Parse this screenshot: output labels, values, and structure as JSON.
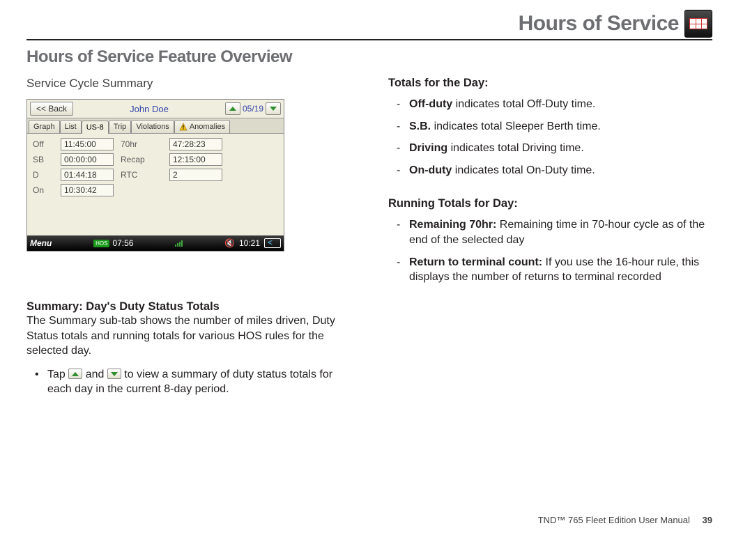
{
  "header": {
    "title": "Hours of Service"
  },
  "h2": "Hours of Service Feature Overview",
  "left": {
    "subhead": "Service Cycle Summary",
    "summary_head": "Summary: Day's Duty Status Totals",
    "summary_body": "The Summary sub-tab shows the number of miles driven, Duty Status totals and running totals for various HOS rules for the selected day.",
    "bullet_pre": "Tap ",
    "bullet_mid": " and ",
    "bullet_post": " to view a summary of duty status totals for each day in the current 8-day period."
  },
  "right": {
    "totals_head": "Totals for the Day:",
    "totals": [
      {
        "b": "Off-duty",
        "t": " indicates total Off-Duty time."
      },
      {
        "b": "S.B.",
        "t": " indicates total Sleeper Berth time."
      },
      {
        "b": "Driving",
        "t": " indicates total Driving time."
      },
      {
        "b": "On-duty",
        "t": " indicates total On-Duty time."
      }
    ],
    "running_head": "Running Totals for Day:",
    "running": [
      {
        "b": "Remaining 70hr:",
        "t": " Remaining time in 70-hour cycle as of the end of the selected day"
      },
      {
        "b": "Return to terminal count:",
        "t": " If you use the 16-hour rule, this displays the number of returns to terminal recorded"
      }
    ]
  },
  "shot": {
    "back": "<< Back",
    "name": "John Doe",
    "date": "05/19",
    "tabs": {
      "graph": "Graph",
      "list": "List",
      "us8": "US-8",
      "trip": "Trip",
      "violations": "Violations",
      "anomalies": "Anomalies"
    },
    "rows": {
      "off_l": "Off",
      "off_v": "11:45:00",
      "sb_l": "SB",
      "sb_v": "00:00:00",
      "d_l": "D",
      "d_v": "01:44:18",
      "on_l": "On",
      "on_v": "10:30:42",
      "hr70_l": "70hr",
      "hr70_v": "47:28:23",
      "recap_l": "Recap",
      "recap_v": "12:15:00",
      "rtc_l": "RTC",
      "rtc_v": "2"
    },
    "status": {
      "menu": "Menu",
      "hos": "HOS",
      "hos_time": "07:56",
      "clock": "10:21"
    }
  },
  "footer": {
    "text": "TND™ 765 Fleet Edition User Manual",
    "page": "39"
  }
}
